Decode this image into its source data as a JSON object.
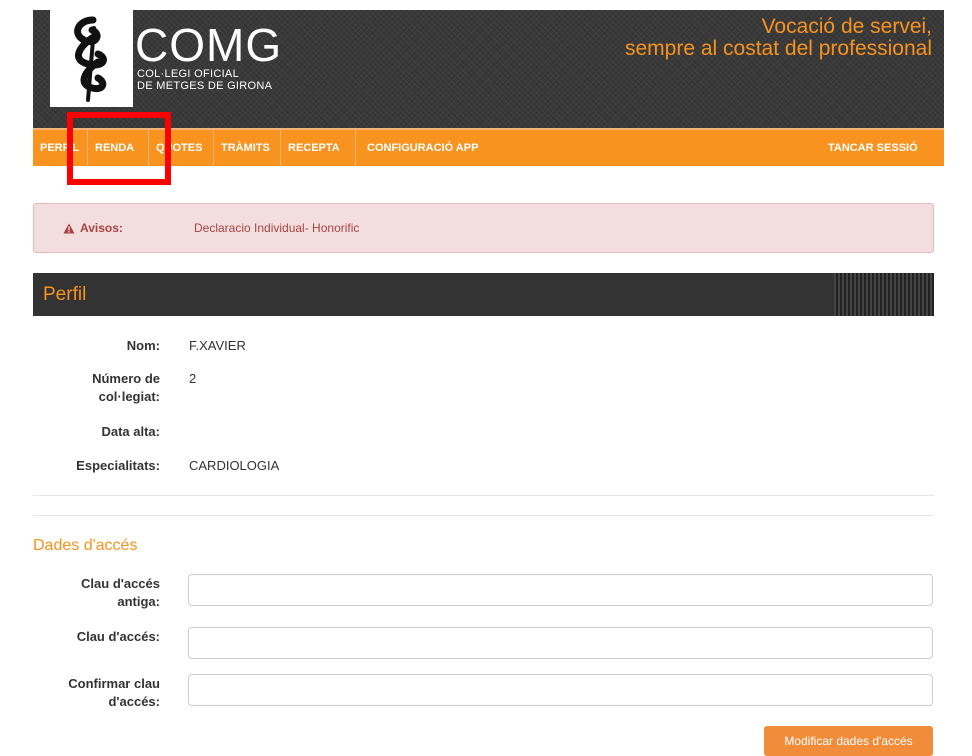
{
  "header": {
    "logo_title": "COMG",
    "logo_sub_line1": "COL·LEGI OFICIAL",
    "logo_sub_line2": "DE METGES DE GIRONA",
    "tagline_line1": "Vocació de servei,",
    "tagline_line2": "sempre al costat del professional"
  },
  "nav": {
    "items": [
      "PERFIL",
      "RENDA",
      "QUOTES",
      "TRÀMITS",
      "RECEPTA",
      "CONFIGURACIÓ APP"
    ],
    "logout": "TANCAR SESSIÓ"
  },
  "alert": {
    "label": "Avisos:",
    "text": "Declaracio Individual- Honorific"
  },
  "profile": {
    "title": "Perfil",
    "fields": [
      {
        "label_line1": "Nom:",
        "label_line2": "",
        "value": "F.XAVIER"
      },
      {
        "label_line1": "Número de",
        "label_line2": "col·legiat:",
        "value": "2"
      },
      {
        "label_line1": "Data alta:",
        "label_line2": "",
        "value": ""
      },
      {
        "label_line1": "Especialitats:",
        "label_line2": "",
        "value": "CARDIOLOGIA"
      }
    ]
  },
  "access": {
    "title": "Dades d'accés",
    "fields": [
      {
        "label_line1": "Clau d'accés",
        "label_line2": "antiga:",
        "value": ""
      },
      {
        "label_line1": "Clau d'accés:",
        "label_line2": "",
        "value": ""
      },
      {
        "label_line1": "Confirmar clau",
        "label_line2": "d'accés:",
        "value": ""
      }
    ],
    "submit_label": "Modificar dades d'accés"
  },
  "colors": {
    "accent": "#f7931e",
    "header_bg": "#333333",
    "alert_bg": "#f2dede",
    "alert_text": "#a94442",
    "highlight": "#ff0000"
  },
  "icons": {
    "logo": "caduceus-logo",
    "alert": "warning-triangle-icon"
  }
}
